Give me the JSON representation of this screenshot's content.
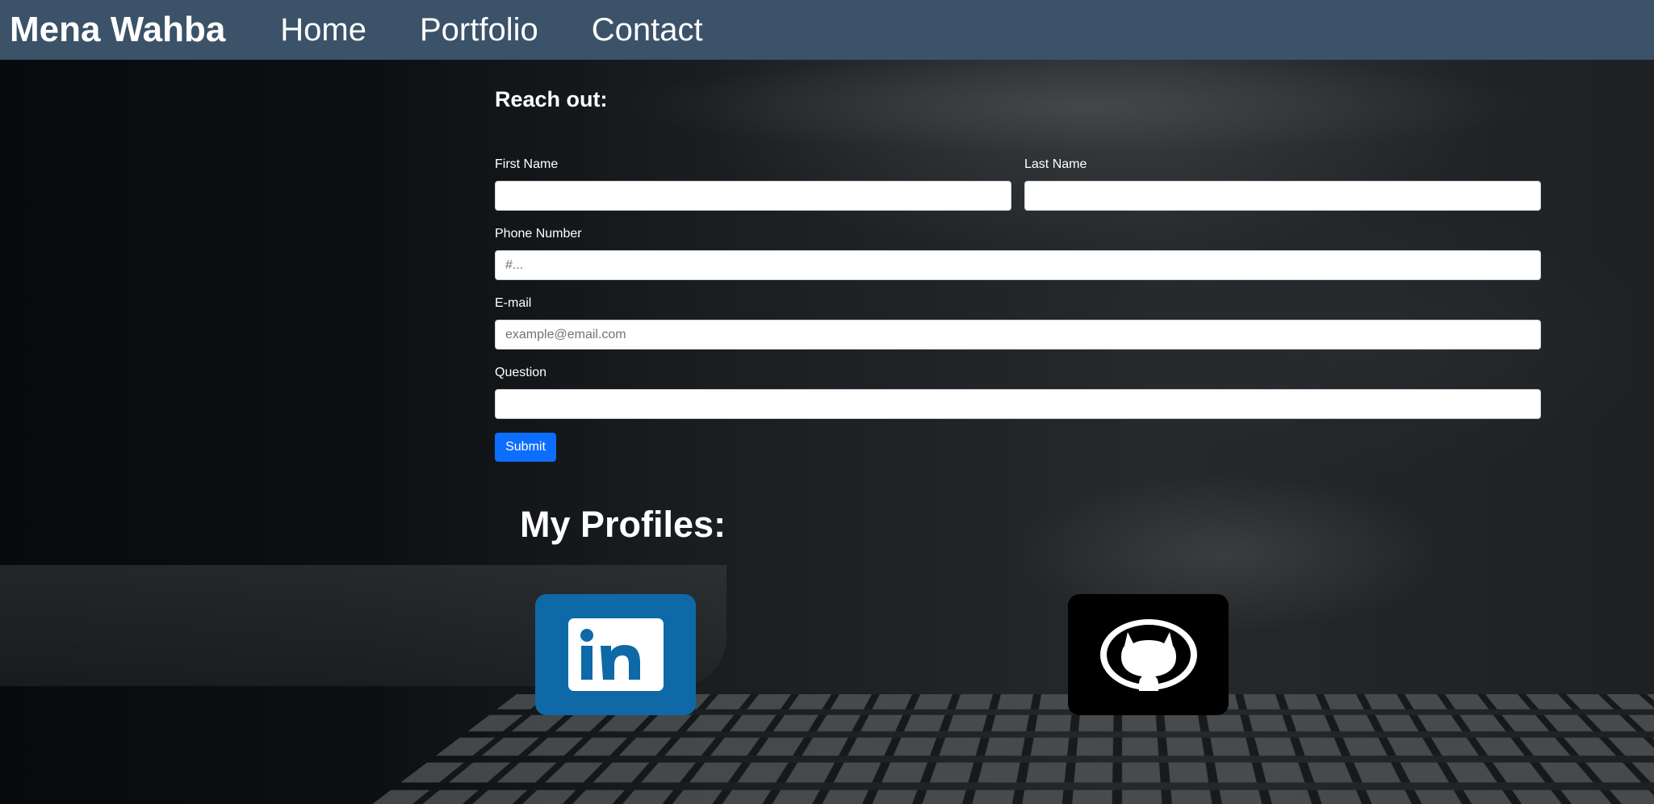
{
  "navbar": {
    "brand": "Mena Wahba",
    "links": [
      {
        "label": "Home"
      },
      {
        "label": "Portfolio"
      },
      {
        "label": "Contact"
      }
    ]
  },
  "form": {
    "heading": "Reach out:",
    "first_name": {
      "label": "First Name",
      "value": "",
      "placeholder": ""
    },
    "last_name": {
      "label": "Last Name",
      "value": "",
      "placeholder": ""
    },
    "phone": {
      "label": "Phone Number",
      "value": "",
      "placeholder": "#..."
    },
    "email": {
      "label": "E-mail",
      "value": "",
      "placeholder": "example@email.com"
    },
    "question": {
      "label": "Question",
      "value": "",
      "placeholder": ""
    },
    "submit_label": "Submit"
  },
  "profiles": {
    "heading": "My Profiles:",
    "items": [
      {
        "icon": "linkedin-icon",
        "color": "#0e69a6"
      },
      {
        "icon": "github-icon",
        "color": "#000000"
      }
    ]
  },
  "colors": {
    "navbar": "#3b5268",
    "submit": "#0d6efd"
  }
}
